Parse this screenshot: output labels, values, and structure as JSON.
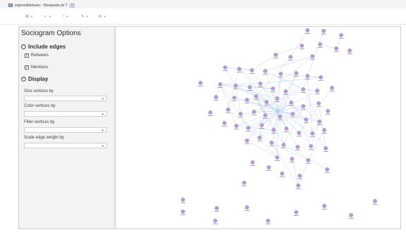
{
  "tab": {
    "title": "eaprendidelsaac - Búsqueda de T",
    "close_icon": "×"
  },
  "toolbar": {
    "buttons": [
      {
        "name": "layout-icon",
        "glyph": "⊞"
      },
      {
        "name": "nodes-icon",
        "glyph": "⚬"
      },
      {
        "name": "circle-icon",
        "glyph": "○"
      },
      {
        "name": "pen-icon",
        "glyph": "✎"
      },
      {
        "name": "link-icon",
        "glyph": "⊖"
      }
    ]
  },
  "panel": {
    "title": "Sociogram Options",
    "include_edges": {
      "heading": "Include edges",
      "toggle": "^",
      "retweets": {
        "label": "Retweets",
        "checked": true
      },
      "mentions": {
        "label": "Mentions",
        "checked": true
      }
    },
    "display": {
      "heading": "Display",
      "toggle": "^",
      "size_vertices_by": {
        "label": "Size vertices by",
        "value": ""
      },
      "color_vertices_by": {
        "label": "Color vertices by",
        "value": ""
      },
      "filter_vertices_by": {
        "label": "Filter vertices by",
        "value": ""
      },
      "scale_edge_weight_by": {
        "label": "Scale edge weight by",
        "value": ""
      }
    }
  },
  "colors": {
    "node": "#b99ad8",
    "node_stroke": "#9c7bc2",
    "edge": "#a9c9ea",
    "label": "#8a8a8a"
  }
}
